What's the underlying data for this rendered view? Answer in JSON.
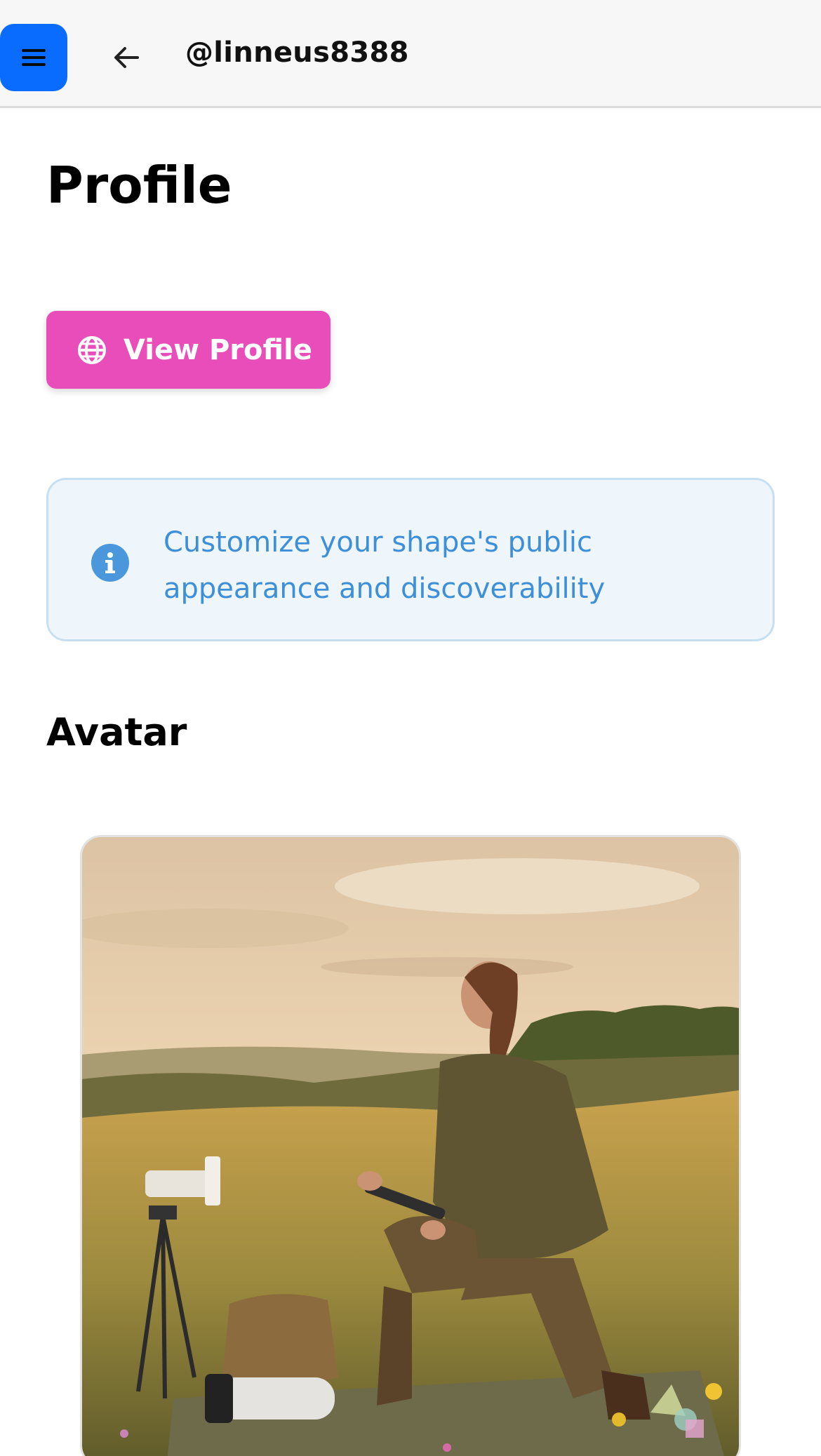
{
  "header": {
    "menu_icon": "hamburger-menu-icon",
    "back_icon": "arrow-left-icon",
    "handle": "@linneus8388",
    "accent_color": "#0a6cff"
  },
  "page": {
    "title": "Profile"
  },
  "view_profile_button": {
    "icon": "globe-icon",
    "label": "View Profile",
    "color": "#e94db9"
  },
  "info_banner": {
    "icon": "info-circle-icon",
    "text": "Customize your shape's public appearance and discoverability",
    "text_color": "#3c8fd8",
    "background": "#eef6fc"
  },
  "avatar_section": {
    "title": "Avatar",
    "image_description_icon": "avatar-image"
  }
}
